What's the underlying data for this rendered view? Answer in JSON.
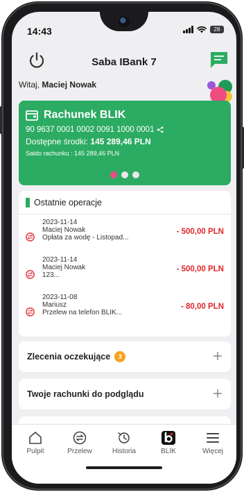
{
  "status_bar": {
    "time": "14:43",
    "battery": "28"
  },
  "header": {
    "title": "Saba IBank 7",
    "power_icon": "power-icon",
    "chat_icon": "chat-icon"
  },
  "greeting": {
    "prefix": "Witaj,",
    "user": "Maciej Nowak"
  },
  "account_card": {
    "name": "Rachunek BLIK",
    "number": "90 9637 0001 0002 0091 1000 0001",
    "available_label": "Dostępne środki:",
    "available_value": "145 289,46 PLN",
    "balance_line": "Saldo rachunku : 145 289,46 PLN",
    "pager_count": 3,
    "pager_active_index": 0
  },
  "operations": {
    "title": "Ostatnie operacje",
    "items": [
      {
        "date": "2023-11-14",
        "name": "Maciej Nowak",
        "desc": "Opłata za wodę - Listopad...",
        "amount": "- 500,00 PLN"
      },
      {
        "date": "2023-11-14",
        "name": "Maciej Nowak",
        "desc": "123...",
        "amount": "- 500,00 PLN"
      },
      {
        "date": "2023-11-08",
        "name": "Mariusz",
        "desc": "Przelew na telefon BLIK...",
        "amount": "- 80,00 PLN"
      }
    ]
  },
  "sections": {
    "pending": {
      "label": "Zlecenia oczekujące",
      "count": "3"
    },
    "view_accounts": {
      "label": "Twoje rachunki do podglądu"
    }
  },
  "bottom_nav": {
    "items": [
      {
        "label": "Pulpit",
        "icon": "home-icon"
      },
      {
        "label": "Przelew",
        "icon": "transfer-icon"
      },
      {
        "label": "Historia",
        "icon": "history-icon"
      },
      {
        "label": "BLIK",
        "icon": "blik-icon"
      },
      {
        "label": "Więcej",
        "icon": "menu-icon"
      }
    ]
  },
  "colors": {
    "card_green": "#2cab62",
    "negative_red": "#e0262b",
    "badge_orange": "#f7a31d",
    "pager_active": "#ef4c82"
  }
}
